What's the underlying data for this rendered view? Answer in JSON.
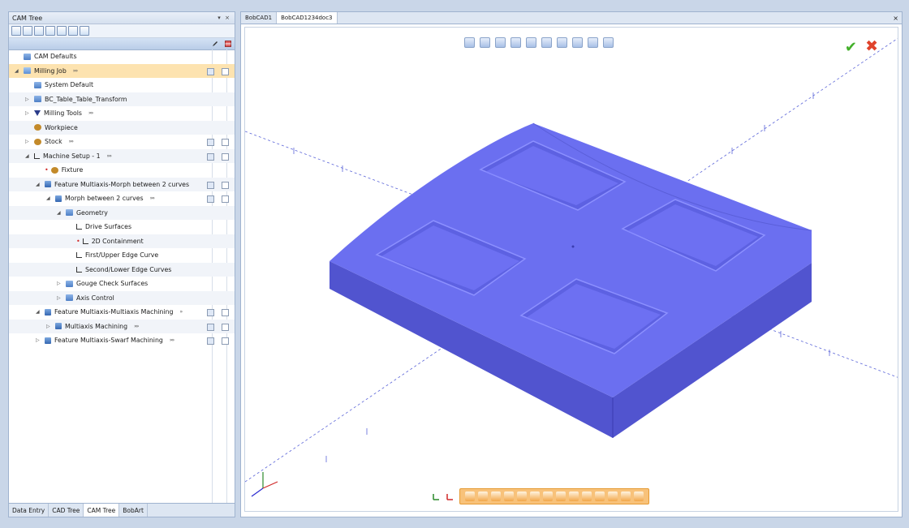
{
  "cam_panel": {
    "title": "CAM Tree",
    "pin": "▾",
    "close": "×",
    "toolbar_icons": 7,
    "rows": [
      {
        "label": "CAM Defaults",
        "indent": 0,
        "icon": "folder",
        "name": "tree-item-cam-defaults"
      },
      {
        "label": "Milling Job",
        "indent": 0,
        "icon": "job",
        "arrows": "»»",
        "cb": true,
        "selected": true,
        "expander": "◢",
        "name": "tree-item-milling-job"
      },
      {
        "label": "System Default",
        "indent": 1,
        "icon": "folder",
        "name": "tree-item-system-default"
      },
      {
        "label": "BC_Table_Table_Transform",
        "indent": 1,
        "icon": "folder",
        "expander": "▷",
        "name": "tree-item-bc-table-transform"
      },
      {
        "label": "Milling Tools",
        "indent": 1,
        "icon": "tool",
        "arrows": "»»",
        "expander": "▷",
        "name": "tree-item-milling-tools"
      },
      {
        "label": "Workpiece",
        "indent": 1,
        "icon": "stock",
        "name": "tree-item-workpiece"
      },
      {
        "label": "Stock",
        "indent": 1,
        "icon": "stock",
        "arrows": "»»",
        "cb": true,
        "expander": "▷",
        "name": "tree-item-stock"
      },
      {
        "label": "Machine Setup - 1",
        "indent": 1,
        "icon": "curve",
        "arrows": "»»",
        "cb": true,
        "expander": "◢",
        "name": "tree-item-machine-setup"
      },
      {
        "label": "Fixture",
        "indent": 2,
        "icon": "fixt",
        "star": true,
        "name": "tree-item-fixture"
      },
      {
        "label": "Feature Multiaxis-Morph between 2 curves",
        "indent": 2,
        "icon": "feat",
        "cb": true,
        "expander": "◢",
        "name": "tree-item-feature-morph"
      },
      {
        "label": "Morph between 2 curves",
        "indent": 3,
        "icon": "feat",
        "arrows": "»»",
        "cb": true,
        "expander": "◢",
        "name": "tree-item-morph"
      },
      {
        "label": "Geometry",
        "indent": 4,
        "icon": "folder",
        "expander": "◢",
        "name": "tree-item-geometry"
      },
      {
        "label": "Drive Surfaces",
        "indent": 5,
        "icon": "curve",
        "name": "tree-item-drive-surfaces"
      },
      {
        "label": "2D Containment",
        "indent": 5,
        "icon": "curve",
        "star": true,
        "name": "tree-item-2d-containment"
      },
      {
        "label": "First/Upper Edge Curve",
        "indent": 5,
        "icon": "curve",
        "name": "tree-item-first-edge-curve"
      },
      {
        "label": "Second/Lower Edge Curves",
        "indent": 5,
        "icon": "curve",
        "name": "tree-item-second-edge-curves"
      },
      {
        "label": "Gouge Check Surfaces",
        "indent": 4,
        "icon": "folder",
        "expander": "▷",
        "name": "tree-item-gouge-check"
      },
      {
        "label": "Axis Control",
        "indent": 4,
        "icon": "folder",
        "expander": "▷",
        "name": "tree-item-axis-control"
      },
      {
        "label": "Feature Multiaxis-Multiaxis Machining",
        "indent": 2,
        "icon": "feat",
        "arrows": "»",
        "cb": true,
        "expander": "◢",
        "name": "tree-item-feature-multiaxis"
      },
      {
        "label": "Multiaxis Machining",
        "indent": 3,
        "icon": "feat",
        "arrows": "»»",
        "cb": true,
        "expander": "▷",
        "name": "tree-item-multiaxis-machining"
      },
      {
        "label": "Feature Multiaxis-Swarf Machining",
        "indent": 2,
        "icon": "feat",
        "arrows": "»»",
        "cb": true,
        "expander": "▷",
        "name": "tree-item-feature-swarf"
      }
    ],
    "bottom_tabs": [
      {
        "label": "Data Entry",
        "active": false
      },
      {
        "label": "CAD Tree",
        "active": false
      },
      {
        "label": "CAM Tree",
        "active": true
      },
      {
        "label": "BobArt",
        "active": false
      }
    ]
  },
  "viewport": {
    "tabs": [
      {
        "label": "BobCAD1",
        "active": false
      },
      {
        "label": "BobCAD1234doc3",
        "active": true
      }
    ],
    "close": "×",
    "ok_symbol": "✔",
    "cancel_symbol": "✖",
    "colors": {
      "part_top": "#6b6ff0",
      "part_side": "#5154cf",
      "accent_orange": "#f8c27a",
      "axis_line": "#5a64d8"
    }
  }
}
